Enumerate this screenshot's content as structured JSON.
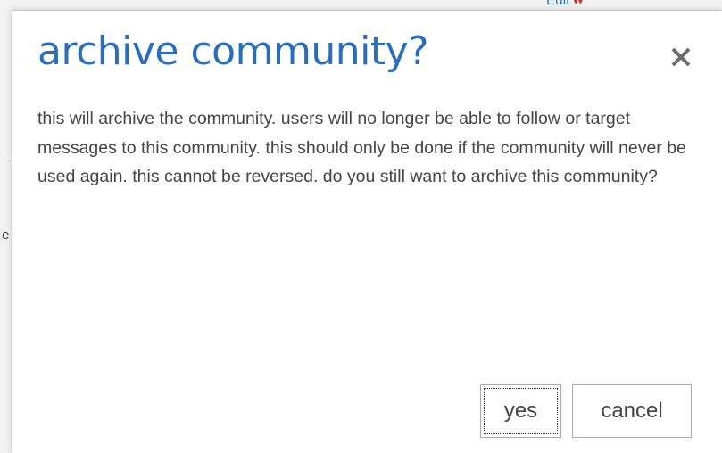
{
  "background": {
    "edit_link": "Edit",
    "edit_arrows": "▾▾",
    "partial_letter": "e"
  },
  "dialog": {
    "title": "archive community?",
    "close_icon": "close-icon",
    "message": "this will archive the community. users will no longer be able to follow or target messages to this community. this should only be done if the community will never be used again. this cannot be reversed. do you still want to archive this community?",
    "yes_label": "yes",
    "cancel_label": "cancel"
  },
  "colors": {
    "title": "#2a6ebb",
    "text": "#444444",
    "button_border": "#ababab",
    "close_icon": "#6d6d6d"
  }
}
